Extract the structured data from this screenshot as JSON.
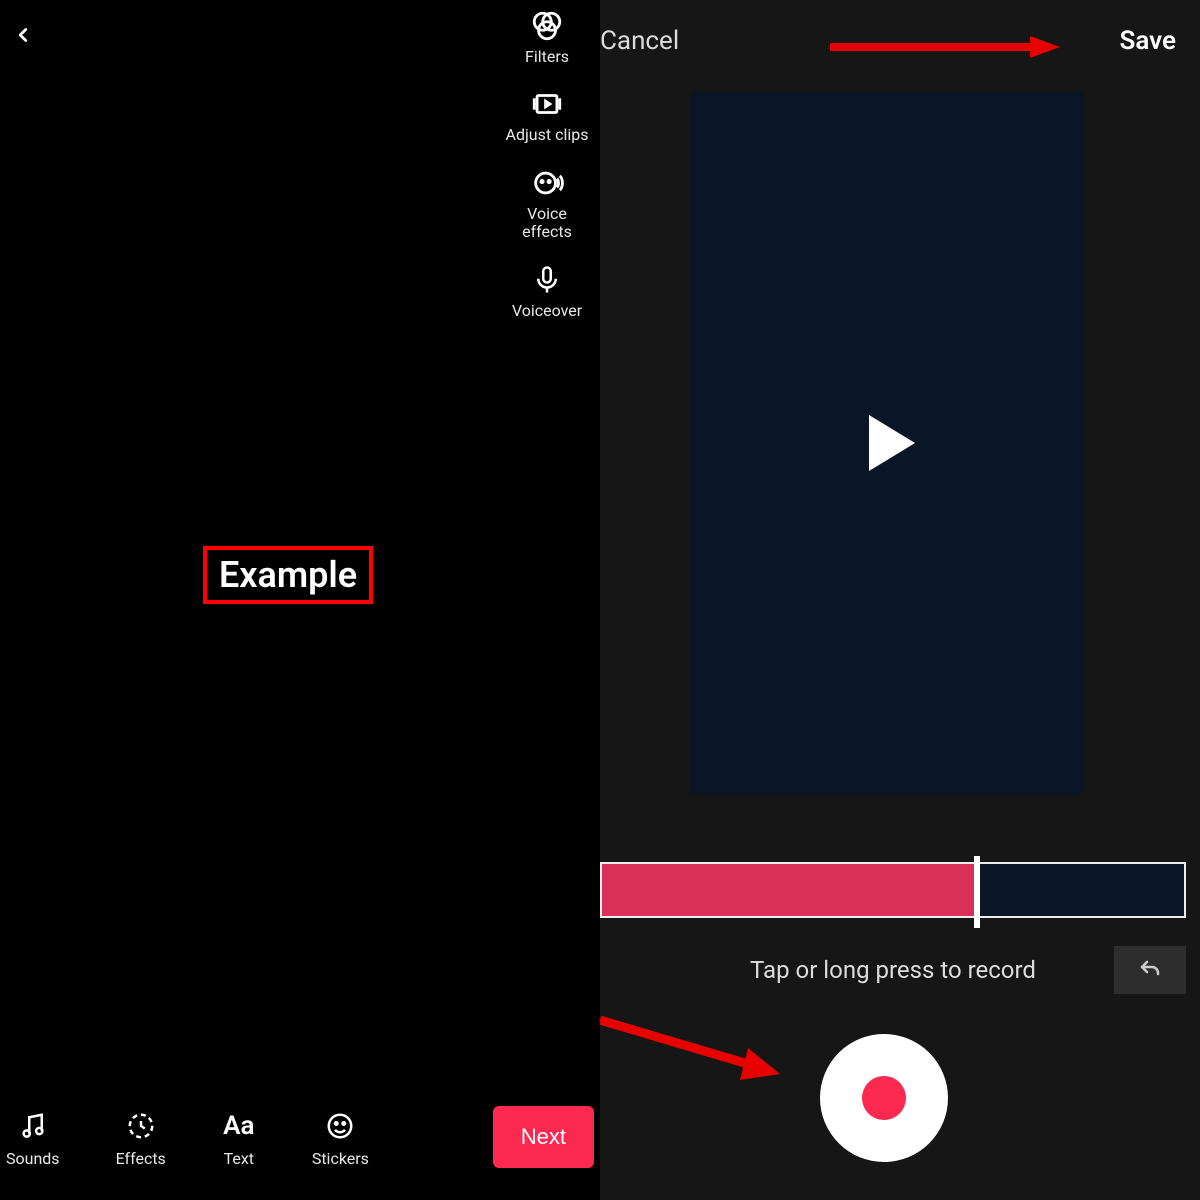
{
  "left": {
    "tools": {
      "filters": "Filters",
      "adjust": "Adjust clips",
      "voice_effects": "Voice\neffects",
      "voiceover": "Voiceover"
    },
    "overlay_text": "Example",
    "bottom": {
      "sounds": "Sounds",
      "effects": "Effects",
      "text": "Text",
      "stickers": "Stickers",
      "next": "Next"
    }
  },
  "right": {
    "cancel": "Cancel",
    "save": "Save",
    "hint": "Tap or long press to record",
    "progress_percent": 64.5
  },
  "annotation": {
    "highlight_color": "#ff0000",
    "arrow_color": "#e60000"
  }
}
